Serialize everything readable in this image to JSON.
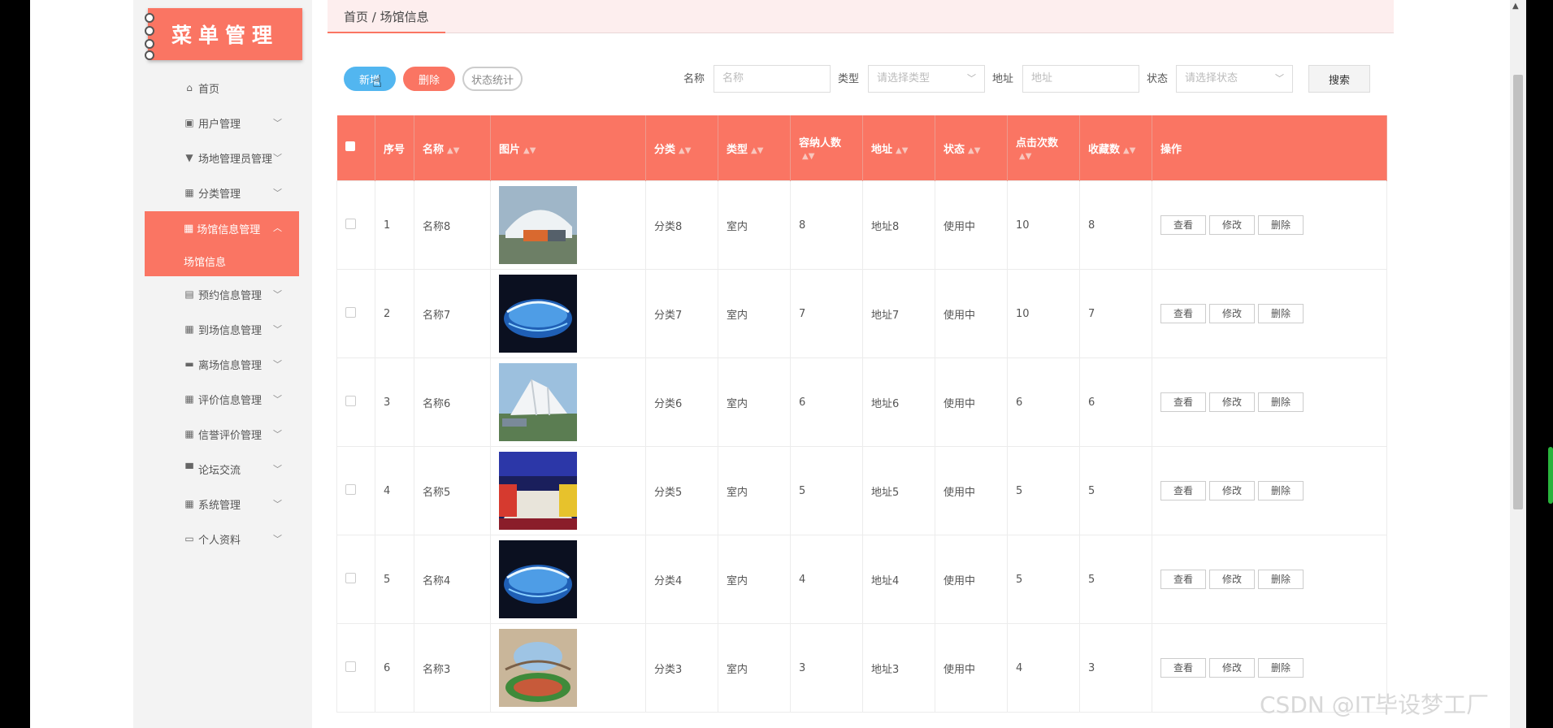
{
  "sidebar": {
    "logo": "菜单管理",
    "items": [
      {
        "label": "首页",
        "icon": "home-icon",
        "glyph": "⌂",
        "expandable": false
      },
      {
        "label": "用户管理",
        "icon": "clipboard-icon",
        "glyph": "▣",
        "expandable": true
      },
      {
        "label": "场地管理员管理",
        "icon": "stamp-icon",
        "glyph": "▼",
        "expandable": true
      },
      {
        "label": "分类管理",
        "icon": "grid-icon",
        "glyph": "▦",
        "expandable": true
      },
      {
        "label": "预约信息管理",
        "icon": "chart-icon",
        "glyph": "▤",
        "expandable": true
      },
      {
        "label": "到场信息管理",
        "icon": "grid-icon",
        "glyph": "▦",
        "expandable": true
      },
      {
        "label": "离场信息管理",
        "icon": "briefcase-icon",
        "glyph": "▬",
        "expandable": true
      },
      {
        "label": "评价信息管理",
        "icon": "grid-icon",
        "glyph": "▦",
        "expandable": true
      },
      {
        "label": "信誉评价管理",
        "icon": "grid-icon",
        "glyph": "▦",
        "expandable": true
      },
      {
        "label": "论坛交流",
        "icon": "chat-icon",
        "glyph": "▀",
        "expandable": true
      },
      {
        "label": "系统管理",
        "icon": "grid-icon",
        "glyph": "▦",
        "expandable": true
      },
      {
        "label": "个人资料",
        "icon": "id-card-icon",
        "glyph": "▭",
        "expandable": true
      }
    ],
    "active": {
      "label": "场馆信息管理",
      "sub": "场馆信息",
      "icon": "grid-icon"
    }
  },
  "breadcrumb": "首页 / 场馆信息",
  "toolbar": {
    "add": "新增",
    "delete": "删除",
    "stats": "状态统计"
  },
  "filters": {
    "name_label": "名称",
    "name_placeholder": "名称",
    "type_label": "类型",
    "type_placeholder": "请选择类型",
    "addr_label": "地址",
    "addr_placeholder": "地址",
    "status_label": "状态",
    "status_placeholder": "请选择状态",
    "search": "搜索"
  },
  "table": {
    "headers": {
      "index": "序号",
      "name": "名称",
      "image": "图片",
      "category": "分类",
      "type": "类型",
      "capacity": "容纳人数",
      "address": "地址",
      "status": "状态",
      "clicks": "点击次数",
      "favorites": "收藏数",
      "actions": "操作"
    },
    "action_labels": {
      "view": "查看",
      "edit": "修改",
      "delete": "删除"
    },
    "rows": [
      {
        "index": "1",
        "name": "名称8",
        "category": "分类8",
        "type": "室内",
        "capacity": "8",
        "address": "地址8",
        "status": "使用中",
        "clicks": "10",
        "favorites": "8",
        "thumb": "stadium-white-roof"
      },
      {
        "index": "2",
        "name": "名称7",
        "category": "分类7",
        "type": "室内",
        "capacity": "7",
        "address": "地址7",
        "status": "使用中",
        "clicks": "10",
        "favorites": "7",
        "thumb": "stadium-blue-night"
      },
      {
        "index": "3",
        "name": "名称6",
        "category": "分类6",
        "type": "室内",
        "capacity": "6",
        "address": "地址6",
        "status": "使用中",
        "clicks": "6",
        "favorites": "6",
        "thumb": "stadium-white-daylight"
      },
      {
        "index": "4",
        "name": "名称5",
        "category": "分类5",
        "type": "室内",
        "capacity": "5",
        "address": "地址5",
        "status": "使用中",
        "clicks": "5",
        "favorites": "5",
        "thumb": "arena-interior"
      },
      {
        "index": "5",
        "name": "名称4",
        "category": "分类4",
        "type": "室内",
        "capacity": "4",
        "address": "地址4",
        "status": "使用中",
        "clicks": "5",
        "favorites": "5",
        "thumb": "stadium-blue-night"
      },
      {
        "index": "6",
        "name": "名称3",
        "category": "分类3",
        "type": "室内",
        "capacity": "3",
        "address": "地址3",
        "status": "使用中",
        "clicks": "4",
        "favorites": "3",
        "thumb": "stadium-open-roof"
      }
    ]
  },
  "watermark": "CSDN @IT毕设梦工厂",
  "colors": {
    "accent": "#fa7563",
    "add_button": "#52b6f0",
    "sidebar_bg": "#f3f3f3"
  }
}
